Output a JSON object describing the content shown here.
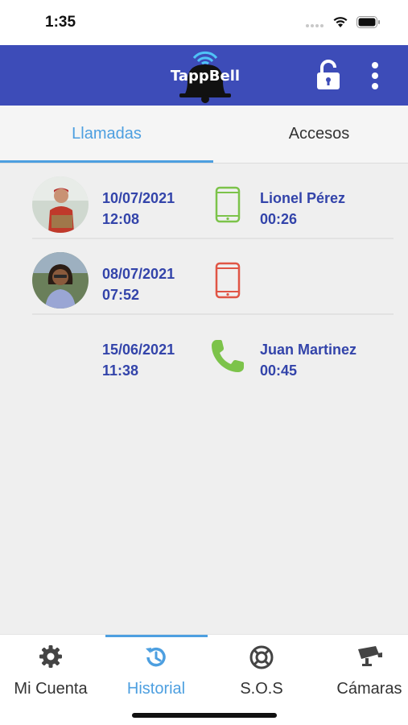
{
  "status_bar": {
    "time": "1:35"
  },
  "header": {
    "logo_text": "TappBell"
  },
  "tabs": [
    {
      "label": "Llamadas",
      "active": true
    },
    {
      "label": "Accesos",
      "active": false
    }
  ],
  "calls": [
    {
      "date": "10/07/2021",
      "time": "12:08",
      "type": "phone-answered-icon",
      "type_color": "#7cc34a",
      "caller": "Lionel Pérez",
      "duration": "00:26",
      "has_avatar": true
    },
    {
      "date": "08/07/2021",
      "time": "07:52",
      "type": "phone-missed-icon",
      "type_color": "#e05545",
      "caller": "",
      "duration": "",
      "has_avatar": true
    },
    {
      "date": "15/06/2021",
      "time": "11:38",
      "type": "handset-icon",
      "type_color": "#7cc34a",
      "caller": "Juan Martinez",
      "duration": "00:45",
      "has_avatar": false
    }
  ],
  "bottom_nav": [
    {
      "label": "Mi Cuenta",
      "icon": "gear-icon",
      "active": false
    },
    {
      "label": "Historial",
      "icon": "history-icon",
      "active": true
    },
    {
      "label": "S.O.S",
      "icon": "lifebuoy-icon",
      "active": false
    },
    {
      "label": "Cámaras",
      "icon": "camera-icon",
      "active": false
    }
  ],
  "colors": {
    "header": "#3d4cb8",
    "accent": "#4d9fe0",
    "text_blue": "#3344aa"
  }
}
